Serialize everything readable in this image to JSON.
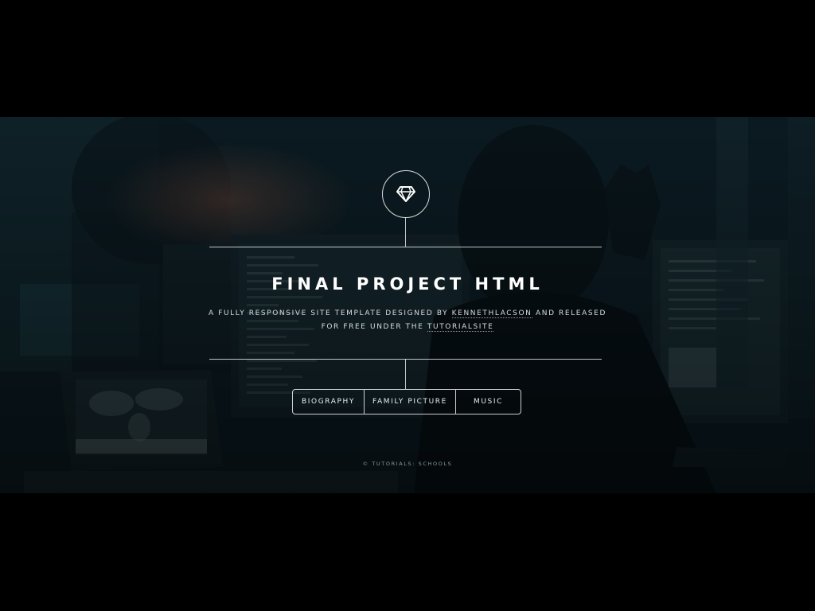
{
  "header": {
    "logo_icon": "diamond-icon"
  },
  "main": {
    "title": "FINAL PROJECT HTML",
    "subtitle": {
      "part1": "A FULLY RESPONSIVE SITE TEMPLATE DESIGNED BY ",
      "link1": "KENNETHLACSON",
      "part2": " AND RELEASED FOR FREE UNDER THE ",
      "link2": "TUTORIALSITE"
    }
  },
  "nav": {
    "items": [
      {
        "label": "BIOGRAPHY"
      },
      {
        "label": "FAMILY PICTURE"
      },
      {
        "label": "MUSIC"
      }
    ]
  },
  "footer": {
    "text": "© TUTORIALS: SCHOOLS"
  },
  "colors": {
    "background": "#0e1b22",
    "accent": "#ffffff"
  }
}
